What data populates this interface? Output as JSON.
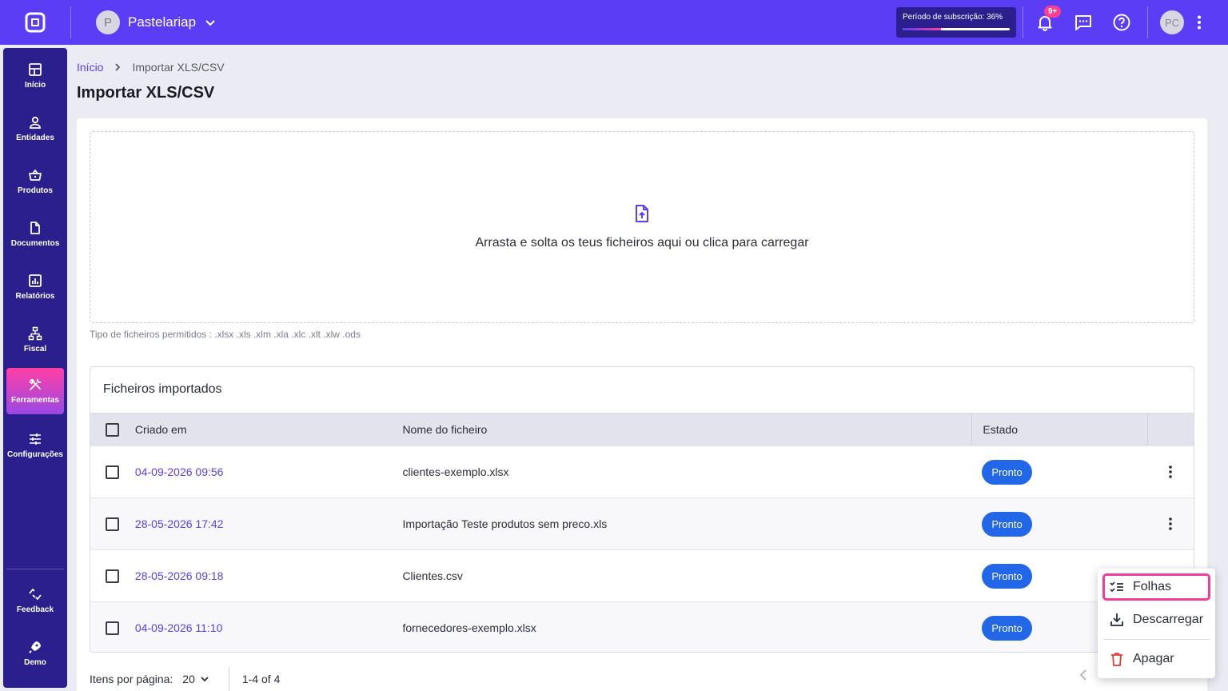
{
  "topbar": {
    "company_initial": "P",
    "company_name": "Pastelariap",
    "subscription_label": "Período de subscrição: 36%",
    "subscription_progress": 36,
    "notifications_badge": "9+",
    "user_initials": "PC"
  },
  "sidebar": {
    "items": [
      {
        "label": "Início",
        "icon": "grid-icon"
      },
      {
        "label": "Entidades",
        "icon": "user-icon"
      },
      {
        "label": "Produtos",
        "icon": "basket-icon"
      },
      {
        "label": "Documentos",
        "icon": "document-icon"
      },
      {
        "label": "Relatórios",
        "icon": "chart-icon"
      },
      {
        "label": "Fiscal",
        "icon": "hierarchy-icon"
      },
      {
        "label": "Ferramentas",
        "icon": "tools-icon",
        "active": true
      },
      {
        "label": "Configurações",
        "icon": "sliders-icon"
      }
    ],
    "bottom": [
      {
        "label": "Feedback",
        "icon": "feedback-icon"
      },
      {
        "label": "Demo",
        "icon": "rocket-icon"
      }
    ]
  },
  "breadcrumb": {
    "home": "Início",
    "current": "Importar XLS/CSV"
  },
  "page_title": "Importar XLS/CSV",
  "dropzone": {
    "text": "Arrasta e solta os teus ficheiros aqui ou clica para carregar",
    "hint": "Tipo de ficheiros permitidos : .xlsx .xls .xlm .xla .xlc .xlt .xlw .ods"
  },
  "table": {
    "title": "Ficheiros importados",
    "headers": {
      "created": "Criado em",
      "name": "Nome do ficheiro",
      "state": "Estado"
    },
    "rows": [
      {
        "created": "04-09-2026 09:56",
        "name": "clientes-exemplo.xlsx",
        "state": "Pronto"
      },
      {
        "created": "28-05-2026 17:42",
        "name": "Importação Teste produtos sem preco.xls",
        "state": "Pronto"
      },
      {
        "created": "28-05-2026 09:18",
        "name": "Clientes.csv",
        "state": "Pronto"
      },
      {
        "created": "04-09-2026 11:10",
        "name": "fornecedores-exemplo.xlsx",
        "state": "Pronto"
      }
    ]
  },
  "pager": {
    "per_page_label": "Itens por página:",
    "per_page_value": "20",
    "range": "1-4 of 4"
  },
  "context_menu": {
    "items": [
      {
        "label": "Folhas",
        "icon": "checklist-icon"
      },
      {
        "label": "Descarregar",
        "icon": "download-icon"
      },
      {
        "label": "Apagar",
        "icon": "trash-icon"
      }
    ]
  },
  "colors": {
    "primary": "#5b3df5",
    "sidebar": "#2a1f8c",
    "active_gradient_start": "#ff3fa4",
    "status_pill": "#2167e8",
    "menu_highlight": "#ee3e9c"
  }
}
